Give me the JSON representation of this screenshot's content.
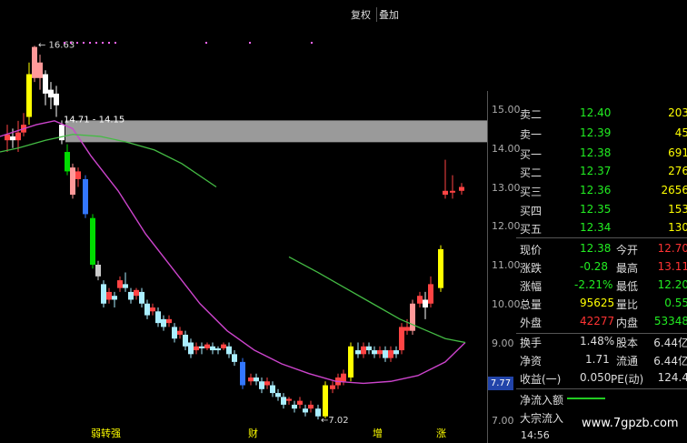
{
  "toolbar": {
    "restore": "复权",
    "overlay": "叠加"
  },
  "chart_data": {
    "type": "candlestick",
    "annotations": {
      "high": "16.63",
      "range": "14.71 - 14.15",
      "low": "7.02"
    },
    "yticks": [
      "15.00",
      "14.00",
      "13.00",
      "12.00",
      "11.00",
      "10.00",
      "9.00",
      "8.00",
      "7.00"
    ],
    "ylim": [
      6.8,
      15.5
    ],
    "current_price": "7.77",
    "bottom_labels": [
      "弱转强",
      "财",
      "增",
      "涨"
    ]
  },
  "quote": {
    "sell2_label": "卖二",
    "sell2_price": "12.40",
    "sell2_vol": "203",
    "sell1_label": "卖一",
    "sell1_price": "12.39",
    "sell1_vol": "45",
    "buy1_label": "买一",
    "buy1_price": "12.38",
    "buy1_vol": "691",
    "buy2_label": "买二",
    "buy2_price": "12.37",
    "buy2_vol": "276",
    "buy3_label": "买三",
    "buy3_price": "12.36",
    "buy3_vol": "2656",
    "buy4_label": "买四",
    "buy4_price": "12.35",
    "buy4_vol": "153",
    "buy5_label": "买五",
    "buy5_price": "12.34",
    "buy5_vol": "130",
    "price_label": "现价",
    "price": "12.38",
    "open_label": "今开",
    "open": "12.70",
    "change_label": "涨跌",
    "change": "-0.28",
    "high_label": "最高",
    "high": "13.11",
    "pct_label": "涨幅",
    "pct": "-2.21%",
    "low_label": "最低",
    "low": "12.20",
    "vol_label": "总量",
    "vol": "95625",
    "ratio_label": "量比",
    "ratio": "0.55",
    "outer_label": "外盘",
    "outer": "42277",
    "inner_label": "内盘",
    "inner": "53348",
    "turnover_label": "换手",
    "turnover": "1.48%",
    "capital_label": "股本",
    "capital": "6.44亿",
    "nav_label": "净资",
    "nav": "1.71",
    "float_label": "流通",
    "float": "6.44亿",
    "eps_label": "收益(一)",
    "eps": "0.050",
    "pe_label": "PE(动)",
    "pe": "124.4",
    "inflow_label": "净流入额",
    "block_label": "大宗流入"
  },
  "time": "14:56",
  "watermark": "www.7gpzb.com"
}
